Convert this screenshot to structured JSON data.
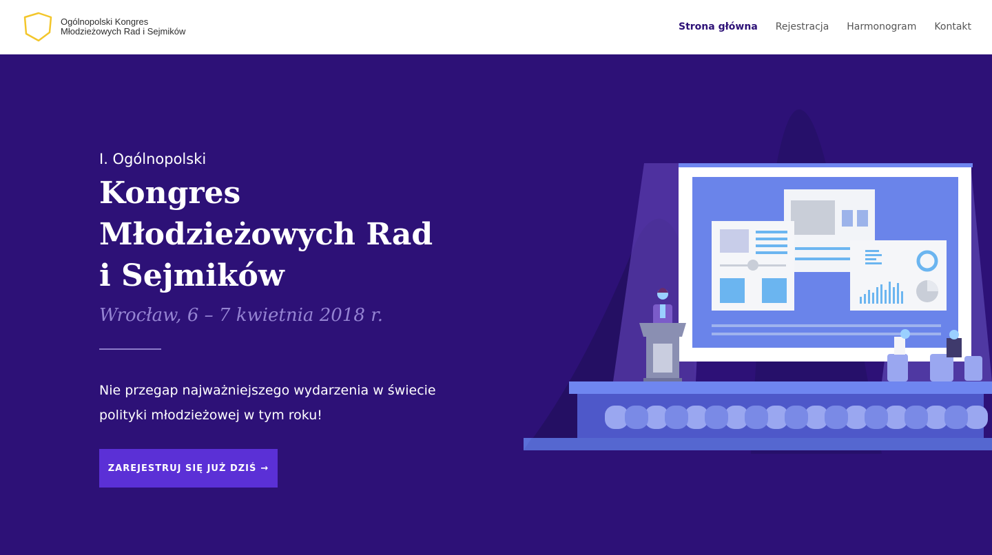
{
  "header": {
    "logo_line1": "Ogólnopolski Kongres",
    "logo_line2": "Młodzieżowych Rad i Sejmików",
    "nav": [
      {
        "label": "Strona główna",
        "active": true
      },
      {
        "label": "Rejestracja",
        "active": false
      },
      {
        "label": "Harmonogram",
        "active": false
      },
      {
        "label": "Kontakt",
        "active": false
      }
    ]
  },
  "hero": {
    "pre_title": "I. Ogólnopolski",
    "title_lines": [
      "Kongres",
      "Młodzieżowych Rad",
      "i Sejmików"
    ],
    "date": "Wrocław, 6 – 7 kwietnia 2018 r.",
    "lead": "Nie przegap najważniejszego wydarzenia w świecie polityki młodzieżowej w tym roku!",
    "cta_label": "ZAREJESTRUJ SIĘ JUŻ DZIŚ",
    "cta_icon": "arrow-right-icon"
  },
  "colors": {
    "hero_bg": "#2d1177",
    "accent": "#5b30d6",
    "logo_outline": "#f3c62b",
    "date_text": "#9584d3"
  }
}
